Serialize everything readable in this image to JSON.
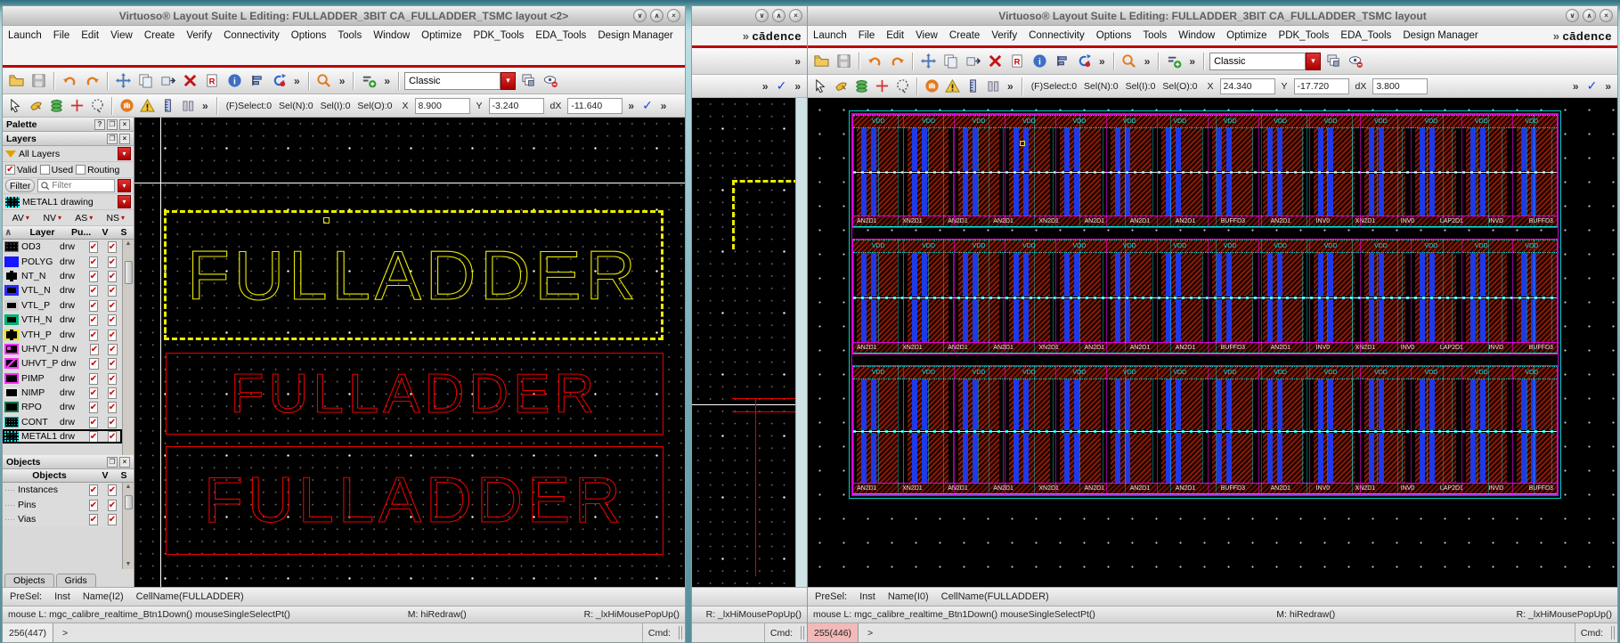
{
  "glyphs": {
    "overflow": "»",
    "check": "✓",
    "red_check": "✔",
    "dropdown": "▾",
    "close": "×",
    "maximize": "∧",
    "minimize": "∨",
    "help": "?",
    "float": "❐",
    "sort": "∧",
    "up": "▲",
    "down": "▼"
  },
  "brand": "cādence",
  "menu_items": [
    "Launch",
    "File",
    "Edit",
    "View",
    "Create",
    "Verify",
    "Connectivity",
    "Options",
    "Tools",
    "Window",
    "Optimize",
    "PDK_Tools",
    "EDA_Tools",
    "Design Manager"
  ],
  "windows": {
    "left": {
      "title": "Virtuoso® Layout Suite L Editing: FULLADDER_3BIT CA_FULLADDER_TSMC layout <2>",
      "style_combo": "Classic",
      "sel_counters": [
        "(F)Select:0",
        "Sel(N):0",
        "Sel(I):0",
        "Sel(O):0"
      ],
      "coords": {
        "x_label": "X",
        "x": "8.900",
        "y_label": "Y",
        "y": "-3.240",
        "dx_label": "dX",
        "dx": "-11.640"
      },
      "presel_items": [
        "PreSel:",
        "Inst",
        "Name(I2)",
        "CellName(FULLADDER)"
      ],
      "mouse": {
        "l": "mouse L: mgc_calibre_realtime_Btn1Down() mouseSingleSelectPt()",
        "m": "M: hiRedraw()",
        "r": "R: _lxHiMousePopUp()"
      },
      "cmd": {
        "counter": "256(447)",
        "prompt": ">",
        "label": "Cmd:"
      },
      "canvas_label": "FULLADDER"
    },
    "right": {
      "title": "Virtuoso® Layout Suite L Editing: FULLADDER_3BIT CA_FULLADDER_TSMC layout",
      "style_combo": "Classic",
      "sel_counters": [
        "(F)Select:0",
        "Sel(N):0",
        "Sel(I):0",
        "Sel(O):0"
      ],
      "coords": {
        "x_label": "X",
        "x": "24.340",
        "y_label": "Y",
        "y": "-17.720",
        "dx_label": "dX",
        "dx": "3.800"
      },
      "presel_items": [
        "PreSel:",
        "Inst",
        "Name(I0)",
        "CellName(FULLADDER)"
      ],
      "mouse": {
        "l": "mouse L: mgc_calibre_realtime_Btn1Down() mouseSingleSelectPt()",
        "m": "M: hiRedraw()",
        "r": "R: _lxHiMousePopUp()"
      },
      "cmd": {
        "counter": "255(446)",
        "prompt": ">",
        "label": "Cmd:"
      }
    },
    "middle": {
      "mouse_r": "R: _lxHiMousePopUp()",
      "cmd_label": "Cmd:"
    }
  },
  "palette": {
    "title": "Palette",
    "layers_title": "Layers",
    "all_layers": "All Layers",
    "checks": [
      {
        "label": "Valid",
        "checked": true
      },
      {
        "label": "Used",
        "checked": false
      },
      {
        "label": "Routing",
        "checked": false
      }
    ],
    "filter_button": "Filter",
    "filter_placeholder": "Filter",
    "active_layer": "METAL1 drawing",
    "vis_controls": [
      "AV",
      "NV",
      "AS",
      "NS"
    ],
    "table": {
      "headers": {
        "layer": "Layer",
        "purpose": "Pu...",
        "v": "V",
        "s": "S"
      },
      "layers": [
        {
          "name": "OD3",
          "purpose": "drw",
          "swatch": "sw-od3"
        },
        {
          "name": "POLYG",
          "purpose": "drw",
          "swatch": "sw-polyg"
        },
        {
          "name": "NT_N",
          "purpose": "drw",
          "swatch": "sw-ntn"
        },
        {
          "name": "VTL_N",
          "purpose": "drw",
          "swatch": "sw-vtln"
        },
        {
          "name": "VTL_P",
          "purpose": "drw",
          "swatch": "sw-vtlp"
        },
        {
          "name": "VTH_N",
          "purpose": "drw",
          "swatch": "sw-vthn"
        },
        {
          "name": "VTH_P",
          "purpose": "drw",
          "swatch": "sw-vthp"
        },
        {
          "name": "UHVT_N",
          "purpose": "drw",
          "swatch": "sw-uhvtn"
        },
        {
          "name": "UHVT_P",
          "purpose": "drw",
          "swatch": "sw-uhvtp"
        },
        {
          "name": "PIMP",
          "purpose": "drw",
          "swatch": "sw-pimp"
        },
        {
          "name": "NIMP",
          "purpose": "drw",
          "swatch": "sw-nimp"
        },
        {
          "name": "RPO",
          "purpose": "drw",
          "swatch": "sw-rpo"
        },
        {
          "name": "CONT",
          "purpose": "drw",
          "swatch": "sw-cont"
        },
        {
          "name": "METAL1",
          "purpose": "drw",
          "swatch": "sw-metal1",
          "selected": true
        }
      ]
    },
    "objects_title": "Objects",
    "objects_header": "Objects",
    "objects": [
      "Instances",
      "Pins",
      "Vias"
    ],
    "tabs": [
      "Objects",
      "Grids"
    ]
  },
  "layout": {
    "vdd_labels": [
      "VDD",
      "VDD",
      "VDD",
      "VDD",
      "VDD",
      "VDD",
      "VDD",
      "VDD",
      "VDD",
      "VDD",
      "VDD",
      "VDD",
      "VDD",
      "VDD"
    ],
    "cell_labels": [
      "AN2D1",
      "XN2D1",
      "AN2D1",
      "AN2D1",
      "XN2D1",
      "AN2D1",
      "AN2D1",
      "AN2D1",
      "BUFFD3",
      "AN2D1",
      "INV0",
      "XN2D1",
      "INV0",
      "LAP2D1",
      "INVD",
      "BUFFD3"
    ]
  }
}
